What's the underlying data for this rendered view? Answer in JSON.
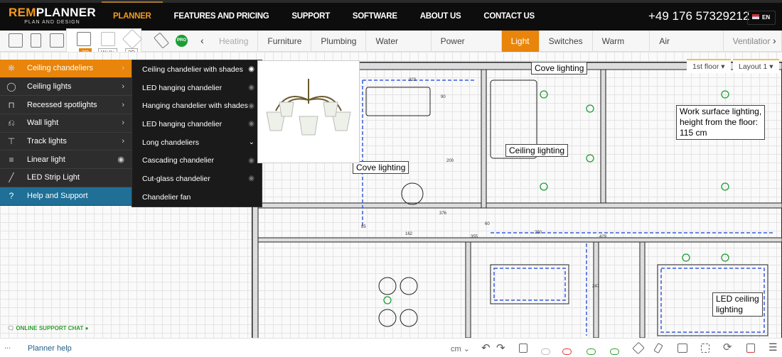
{
  "header": {
    "logo": {
      "rem": "REM",
      "planner": "PLANNER",
      "tagline": "PLAN AND DESIGN"
    },
    "nav": [
      "PLANNER",
      "FEATURES AND PRICING",
      "SUPPORT",
      "SOFTWARE",
      "ABOUT US",
      "CONTACT US"
    ],
    "phone": "+49 176 57329212",
    "lang": "EN"
  },
  "toolbar": {
    "view_modes": [
      "2D",
      "Walls",
      "3D"
    ],
    "pro": "PRO",
    "tabs": [
      "Heating",
      "Furniture",
      "Plumbing",
      "Water supply",
      "Power sockets",
      "Light",
      "Switches",
      "Warm floor",
      "Air conditioners",
      "Ventilation"
    ],
    "active_tab": "Light"
  },
  "menu": [
    {
      "label": "Ceiling chandeliers",
      "icon": "chandelier-icon"
    },
    {
      "label": "Ceiling lights",
      "icon": "ceiling-light-icon"
    },
    {
      "label": "Recessed spotlights",
      "icon": "spotlight-icon"
    },
    {
      "label": "Wall light",
      "icon": "wall-light-icon"
    },
    {
      "label": "Track lights",
      "icon": "track-light-icon"
    },
    {
      "label": "Linear light",
      "icon": "linear-light-icon"
    },
    {
      "label": "LED Strip Light",
      "icon": "led-strip-icon"
    },
    {
      "label": "Help and Support",
      "icon": "question-icon"
    }
  ],
  "submenu": [
    "Ceiling chandelier with shades",
    "LED hanging chandelier",
    "Hanging chandelier with shades",
    "LED hanging chandelier",
    "Long chandeliers",
    "Cascading chandelier",
    "Cut-glass chandelier",
    "Chandelier fan"
  ],
  "floor": "1st floor",
  "layout": "Layout 1",
  "labels": {
    "cove1": "Cove lighting",
    "cove2": "Cove lighting",
    "ceiling": "Ceiling lighting",
    "work1": "Work surface lighting,",
    "work2": "height from the floor:",
    "work3": "115 cm",
    "led1": "LED ceiling",
    "led2": "lighting"
  },
  "dims": [
    "323",
    "90",
    "200",
    "376",
    "162",
    "355",
    "250",
    "429",
    "247",
    "85",
    "60"
  ],
  "chat": "ONLINE SUPPORT CHAT",
  "bottom": {
    "help_prefix": "...",
    "help": "Planner help",
    "unit": "cm"
  },
  "colors": {
    "accent": "#e8850a",
    "header": "#0d0d0d",
    "help": "#1f6f96",
    "chat": "#2fa12f"
  }
}
